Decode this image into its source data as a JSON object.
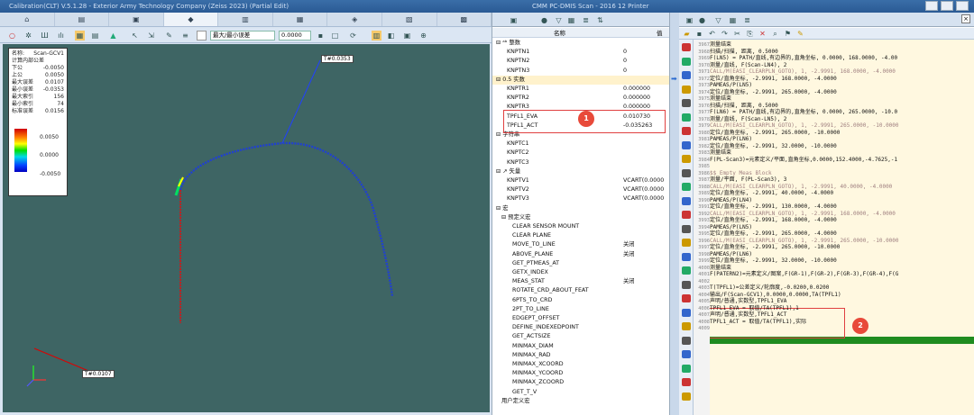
{
  "title": {
    "left": "Calibration(CLT) V.5.1.28 - Exterior Army Technology Company (Zeiss 2023) (Partial Edit)",
    "right": "CMM PC-DMIS Scan - 2016 12 Printer"
  },
  "ribbon_tabs": [
    "",
    "",
    "",
    "",
    "",
    "",
    "",
    "",
    "",
    ""
  ],
  "toolbar": {
    "mode_select": "最大/最小误差",
    "value_input": "0.0000"
  },
  "legend": {
    "name_label": "名称:",
    "name_value": "Scan-GCV1",
    "subtitle": "计算内部公差",
    "rows": [
      {
        "label": "下公",
        "value": "-0.0050"
      },
      {
        "label": "上公",
        "value": "0.0050"
      },
      {
        "label": "最大误差",
        "value": "0.0107"
      },
      {
        "label": "最小误差",
        "value": "-0.0353"
      },
      {
        "label": "最大索引",
        "value": "156"
      },
      {
        "label": "最小索引",
        "value": "74"
      },
      {
        "label": "标准误差",
        "value": "0.0156"
      }
    ],
    "scale": [
      "0.0050",
      "0.0000",
      "-0.0050"
    ]
  },
  "annotations": {
    "top": "T#0.0353",
    "bottom": "T#0.0107"
  },
  "tree": {
    "header": "名称",
    "column": "值",
    "rows": [
      {
        "indent": 0,
        "label": "⊟ ᵃᵇ 整数",
        "value": "",
        "group": false
      },
      {
        "indent": 2,
        "label": "KNPTN1",
        "value": "0",
        "group": false
      },
      {
        "indent": 2,
        "label": "KNPTN2",
        "value": "0",
        "group": false
      },
      {
        "indent": 2,
        "label": "KNPTN3",
        "value": "0",
        "group": false
      },
      {
        "indent": 0,
        "label": "⊟ 0.5 实数",
        "value": "",
        "group": true
      },
      {
        "indent": 2,
        "label": "KNPTR1",
        "value": "0.000000",
        "group": false
      },
      {
        "indent": 2,
        "label": "KNPTR2",
        "value": "0.000000",
        "group": false
      },
      {
        "indent": 2,
        "label": "KNPTR3",
        "value": "0.000000",
        "group": false
      },
      {
        "indent": 2,
        "label": "TPFL1_EVA",
        "value": "0.010730",
        "group": false
      },
      {
        "indent": 2,
        "label": "TPFL1_ACT",
        "value": "-0.035263",
        "group": false
      },
      {
        "indent": 0,
        "label": "⊟ 字符串",
        "value": "",
        "group": false
      },
      {
        "indent": 2,
        "label": "KNPTC1",
        "value": "",
        "group": false
      },
      {
        "indent": 2,
        "label": "KNPTC2",
        "value": "",
        "group": false
      },
      {
        "indent": 2,
        "label": "KNPTC3",
        "value": "",
        "group": false
      },
      {
        "indent": 0,
        "label": "⊟ ↗ 矢量",
        "value": "",
        "group": false
      },
      {
        "indent": 2,
        "label": "KNPTV1",
        "value": "VCART(0.0000",
        "group": false
      },
      {
        "indent": 2,
        "label": "KNPTV2",
        "value": "VCART(0.0000",
        "group": false
      },
      {
        "indent": 2,
        "label": "KNPTV3",
        "value": "VCART(0.0000",
        "group": false
      },
      {
        "indent": 0,
        "label": "⊟ 宏",
        "value": "",
        "group": false
      },
      {
        "indent": 1,
        "label": "⊟ 预定义宏",
        "value": "",
        "group": false
      },
      {
        "indent": 3,
        "label": "CLEAR SENSOR MOUNT",
        "value": "",
        "group": false
      },
      {
        "indent": 3,
        "label": "CLEAR PLANE",
        "value": "",
        "group": false
      },
      {
        "indent": 3,
        "label": "MOVE_TO_LINE",
        "value": "关闭",
        "group": false
      },
      {
        "indent": 3,
        "label": "ABOVE_PLANE",
        "value": "关闭",
        "group": false
      },
      {
        "indent": 3,
        "label": "GET_PTMEAS_AT",
        "value": "",
        "group": false
      },
      {
        "indent": 3,
        "label": "GETX_INDEX",
        "value": "",
        "group": false
      },
      {
        "indent": 3,
        "label": "MEAS_STAT",
        "value": "关闭",
        "group": false
      },
      {
        "indent": 3,
        "label": "ROTATE_CRD_ABOUT_FEAT",
        "value": "",
        "group": false
      },
      {
        "indent": 3,
        "label": "6PTS_TO_CRD",
        "value": "",
        "group": false
      },
      {
        "indent": 3,
        "label": "2PT_TO_LINE",
        "value": "",
        "group": false
      },
      {
        "indent": 3,
        "label": "EDGEPT_OFFSET",
        "value": "",
        "group": false
      },
      {
        "indent": 3,
        "label": "DEFINE_INDEXEDPOINT",
        "value": "",
        "group": false
      },
      {
        "indent": 3,
        "label": "GET_ACTSIZE",
        "value": "",
        "group": false
      },
      {
        "indent": 3,
        "label": "MINMAX_DIAM",
        "value": "",
        "group": false
      },
      {
        "indent": 3,
        "label": "MINMAX_RAD",
        "value": "",
        "group": false
      },
      {
        "indent": 3,
        "label": "MINMAX_XCOORD",
        "value": "",
        "group": false
      },
      {
        "indent": 3,
        "label": "MINMAX_YCOORD",
        "value": "",
        "group": false
      },
      {
        "indent": 3,
        "label": "MINMAX_ZCOORD",
        "value": "",
        "group": false
      },
      {
        "indent": 3,
        "label": "GET_T_V",
        "value": "",
        "group": false
      },
      {
        "indent": 1,
        "label": "用户定义宏",
        "value": "",
        "group": false
      }
    ]
  },
  "badges": {
    "one": "1",
    "two": "2"
  },
  "code": {
    "gutter": [
      "3967",
      "3968",
      "3969",
      "3970",
      "3971",
      "3972",
      "3973",
      "3974",
      "3975",
      "3976",
      "3977",
      "3978",
      "3979",
      "3980",
      "3981",
      "3982",
      "3983",
      "3984",
      "3985",
      "3986",
      "3987",
      "3988",
      "3989",
      "3990",
      "3991",
      "3992",
      "3993",
      "3994",
      "3995",
      "3996",
      "3997",
      "3998",
      "3999",
      "4000",
      "4001",
      "4002",
      "4003",
      "4004",
      "4005",
      "4006",
      "4007",
      "4008",
      "4009"
    ],
    "lines": [
      {
        "t": "测量结束",
        "c": false
      },
      {
        "t": "扫描/扫描, 距离, 0.5000",
        "c": false
      },
      {
        "t": "F(LN5) = PATH/直线,有边界的,直角坐标, 0.0000, 168.0000, -4.00",
        "c": false
      },
      {
        "t": "测量/直线, F(Scan-LN4), 2",
        "c": false
      },
      {
        "t": "  CALL/M(EASI_CLEARPLN_GOTO), 1, -2.9991, 168.0000, -4.0000",
        "c": true
      },
      {
        "t": "  定位/直角坐标, -2.9991, 168.0000, -4.0000",
        "c": false
      },
      {
        "t": "  PAMEAS/P(LN5)",
        "c": false
      },
      {
        "t": "  定位/直角坐标, -2.9991, 265.0000, -4.0000",
        "c": false
      },
      {
        "t": "测量结束",
        "c": false
      },
      {
        "t": "扫描/扫描, 距离, 0.5000",
        "c": false
      },
      {
        "t": "F(LN6) = PATH/直线,有边界的,直角坐标, 0.0000, 265.0000, -10.0",
        "c": false
      },
      {
        "t": "测量/直线, F(Scan-LN5), 2",
        "c": false
      },
      {
        "t": "  CALL/M(EASI_CLEARPLN_GOTO), 1, -2.9991, 265.0000, -10.0000",
        "c": true
      },
      {
        "t": "  定位/直角坐标, -2.9991, 265.0000, -10.0000",
        "c": false
      },
      {
        "t": "  PAMEAS/P(LN6)",
        "c": false
      },
      {
        "t": "  定位/直角坐标, -2.9991, 32.0000, -10.0000",
        "c": false
      },
      {
        "t": "测量结束",
        "c": false
      },
      {
        "t": "F(PL-Scan3)=元素定义/平面,直角坐标,0.0000,152.4000,-4.7625,-1",
        "c": false
      },
      {
        "t": "",
        "c": false
      },
      {
        "t": "$$ Empty Meas Block",
        "c": true
      },
      {
        "t": "测量/平面, F(PL-Scan3), 3",
        "c": false
      },
      {
        "t": "  CALL/M(EASI_CLEARPLN_GOTO), 1, -2.9991, 40.0000, -4.0000",
        "c": true
      },
      {
        "t": "  定位/直角坐标, -2.9991, 40.0000, -4.0000",
        "c": false
      },
      {
        "t": "  PAMEAS/P(LN4)",
        "c": false
      },
      {
        "t": "  定位/直角坐标, -2.9991, 130.0000, -4.0000",
        "c": false
      },
      {
        "t": "  CALL/M(EASI_CLEARPLN_GOTO), 1, -2.9991, 168.0000, -4.0000",
        "c": true
      },
      {
        "t": "  定位/直角坐标, -2.9991, 168.0000, -4.0000",
        "c": false
      },
      {
        "t": "  PAMEAS/P(LN5)",
        "c": false
      },
      {
        "t": "  定位/直角坐标, -2.9991, 265.0000, -4.0000",
        "c": false
      },
      {
        "t": "  CALL/M(EASI_CLEARPLN_GOTO), 1, -2.9991, 265.0000, -10.0000",
        "c": true
      },
      {
        "t": "  定位/直角坐标, -2.9991, 265.0000, -10.0000",
        "c": false
      },
      {
        "t": "  PAMEAS/P(LN6)",
        "c": false
      },
      {
        "t": "  定位/直角坐标, -2.9991, 32.0000, -10.0000",
        "c": false
      },
      {
        "t": "测量结束",
        "c": false
      },
      {
        "t": " F(PATERN2)=元素定义/图案,F(GR-1),F(GR-2),F(GR-3),F(GR-4),F(G",
        "c": false
      },
      {
        "t": "",
        "c": false
      },
      {
        "t": "T(TPFL1)=公差定义/轮廓度,-0.0200,0.0200",
        "c": false
      },
      {
        "t": "  输出/F(Scan-GCV1),0.0000,0.0000,TA(TPFL1)",
        "c": false
      },
      {
        "t": "声明/普通,实数型,TPFL1_EVA",
        "c": false
      },
      {
        "t": "TPFL1_EVA = 取值/TA(TPFL1),1",
        "c": false
      },
      {
        "t": "声明/普通,实数型,TPFL1_ACT",
        "c": false
      },
      {
        "t": "TPFL1_ACT = 取值/TA(TPFL1),实际",
        "c": false
      },
      {
        "t": "",
        "c": false
      }
    ]
  },
  "colors": {
    "accent": "#2a5a94",
    "badge": "#e84a3a",
    "highlight": "#1f8c1f",
    "viewport": "#3e6564"
  }
}
